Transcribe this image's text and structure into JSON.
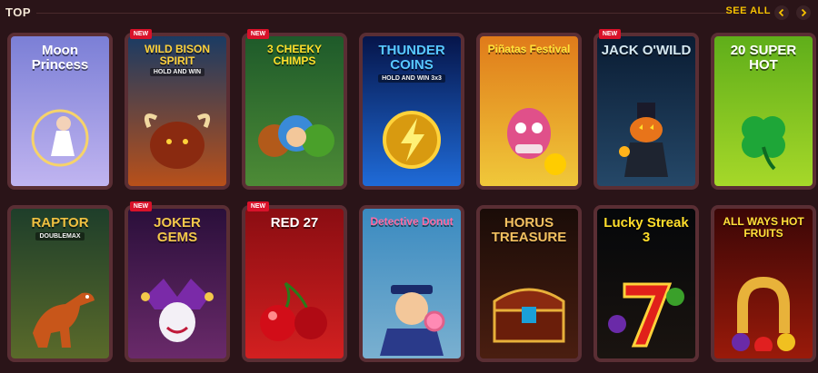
{
  "header": {
    "title": "TOP",
    "see_all": "SEE ALL"
  },
  "badge_label": "NEW",
  "games": [
    {
      "title": "Moon Princess",
      "subtitle": "",
      "new": false,
      "bg": [
        "#7b7fd6",
        "#c0b4f0"
      ],
      "title_color": "#ffffff",
      "icon": "princess-icon"
    },
    {
      "title": "WILD BISON SPIRIT",
      "subtitle": "HOLD AND WIN",
      "new": true,
      "bg": [
        "#1b3b63",
        "#b8501a"
      ],
      "title_color": "#ffd23a",
      "icon": "bison-icon"
    },
    {
      "title": "3 CHEEKY CHIMPS",
      "subtitle": "",
      "new": true,
      "bg": [
        "#1e5a2a",
        "#4d8b36"
      ],
      "title_color": "#ffde2a",
      "icon": "monkey-icon"
    },
    {
      "title": "THUNDER COINS",
      "subtitle": "HOLD AND WIN 3x3",
      "new": false,
      "bg": [
        "#06154a",
        "#1f6bd8"
      ],
      "title_color": "#58c8ff",
      "icon": "lightning-icon"
    },
    {
      "title": "Piñatas Festival",
      "subtitle": "",
      "new": false,
      "bg": [
        "#e07b1a",
        "#f0c83a"
      ],
      "title_color": "#ffe23a",
      "icon": "pinata-icon"
    },
    {
      "title": "JACK O'WILD",
      "subtitle": "",
      "new": true,
      "bg": [
        "#0a1c33",
        "#254868"
      ],
      "title_color": "#d6e8f0",
      "icon": "pumpkin-icon"
    },
    {
      "title": "20 SUPER HOT",
      "subtitle": "",
      "new": false,
      "bg": [
        "#5fae1a",
        "#a6d829"
      ],
      "title_color": "#ffffff",
      "icon": "clover-icon"
    },
    {
      "title": "RAPTOR",
      "subtitle": "DOUBLEMAX",
      "new": false,
      "bg": [
        "#1e3e2a",
        "#5a6a2a"
      ],
      "title_color": "#f0c040",
      "icon": "dinosaur-icon"
    },
    {
      "title": "JOKER GEMS",
      "subtitle": "",
      "new": true,
      "bg": [
        "#2a0f3a",
        "#6a2a6a"
      ],
      "title_color": "#f3c84a",
      "icon": "joker-icon"
    },
    {
      "title": "RED 27",
      "subtitle": "",
      "new": true,
      "bg": [
        "#8a0d12",
        "#d32020"
      ],
      "title_color": "#ffffff",
      "icon": "cherries-icon"
    },
    {
      "title": "Detective Donut",
      "subtitle": "",
      "new": false,
      "bg": [
        "#3a8ac0",
        "#7ab0d0"
      ],
      "title_color": "#ff6aa2",
      "icon": "donut-icon"
    },
    {
      "title": "HORUS TREASURE",
      "subtitle": "",
      "new": false,
      "bg": [
        "#1a0c08",
        "#4a1e10"
      ],
      "title_color": "#f2c060",
      "icon": "chest-icon"
    },
    {
      "title": "Lucky Streak 3",
      "subtitle": "",
      "new": false,
      "bg": [
        "#05070a",
        "#1a1410"
      ],
      "title_color": "#ffde2a",
      "icon": "seven-icon"
    },
    {
      "title": "ALL WAYS HOT FRUITS",
      "subtitle": "",
      "new": false,
      "bg": [
        "#3a0606",
        "#9a1a0a"
      ],
      "title_color": "#ffe23a",
      "icon": "horseshoe-icon"
    }
  ]
}
